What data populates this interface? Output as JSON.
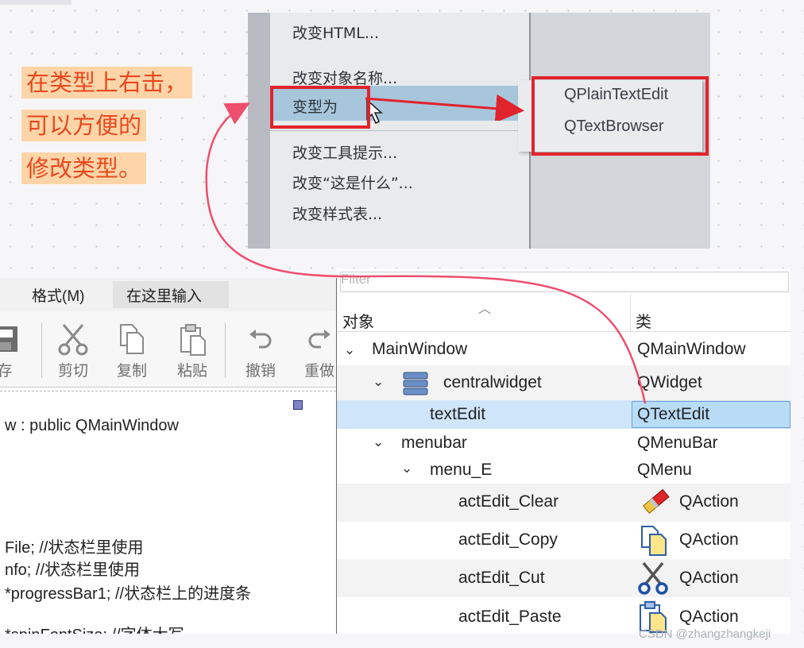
{
  "annotation": {
    "lines": [
      "在类型上右击，",
      "可以方便的",
      "修改类型。"
    ],
    "colors": {
      "text": "#e8491f",
      "background": "#fdd5a8",
      "highlight_box": "#e1232c",
      "connector": "#ee4f6e"
    }
  },
  "context_menu": {
    "items": [
      "改变HTML...",
      "改变对象名称...",
      "变型为",
      "改变工具提示...",
      "改变“这是什么”...",
      "改变样式表..."
    ],
    "submenu": [
      "QPlainTextEdit",
      "QTextBrowser"
    ]
  },
  "editor": {
    "menus": [
      "格式(M)",
      "在这里输入"
    ],
    "toolbar": [
      {
        "label": "存",
        "icon": "save-icon"
      },
      {
        "label": "剪切",
        "icon": "scissors-icon"
      },
      {
        "label": "复制",
        "icon": "copy-icon"
      },
      {
        "label": "粘贴",
        "icon": "paste-icon"
      },
      {
        "label": "撤销",
        "icon": "undo-icon"
      },
      {
        "label": "重做",
        "icon": "redo-icon"
      }
    ],
    "code_lines": [
      "w : public QMainWindow",
      "File;   //状态栏里使用",
      "nfo;   //状态栏里使用",
      "   *progressBar1;  //状态栏上的进度条",
      "  *spinFontSize;  //字体大写"
    ]
  },
  "inspector": {
    "filter_placeholder": "Filter",
    "columns": [
      "对象",
      "类"
    ],
    "rows": [
      {
        "name": "MainWindow",
        "class": "QMainWindow"
      },
      {
        "name": "centralwidget",
        "class": "QWidget"
      },
      {
        "name": "textEdit",
        "class": "QTextEdit"
      },
      {
        "name": "menubar",
        "class": "QMenuBar"
      },
      {
        "name": "menu_E",
        "class": "QMenu"
      },
      {
        "name": "actEdit_Clear",
        "class": "QAction"
      },
      {
        "name": "actEdit_Copy",
        "class": "QAction"
      },
      {
        "name": "actEdit_Cut",
        "class": "QAction"
      },
      {
        "name": "actEdit_Paste",
        "class": "QAction"
      }
    ]
  },
  "watermark": "CSDN @zhangzhangkeji"
}
